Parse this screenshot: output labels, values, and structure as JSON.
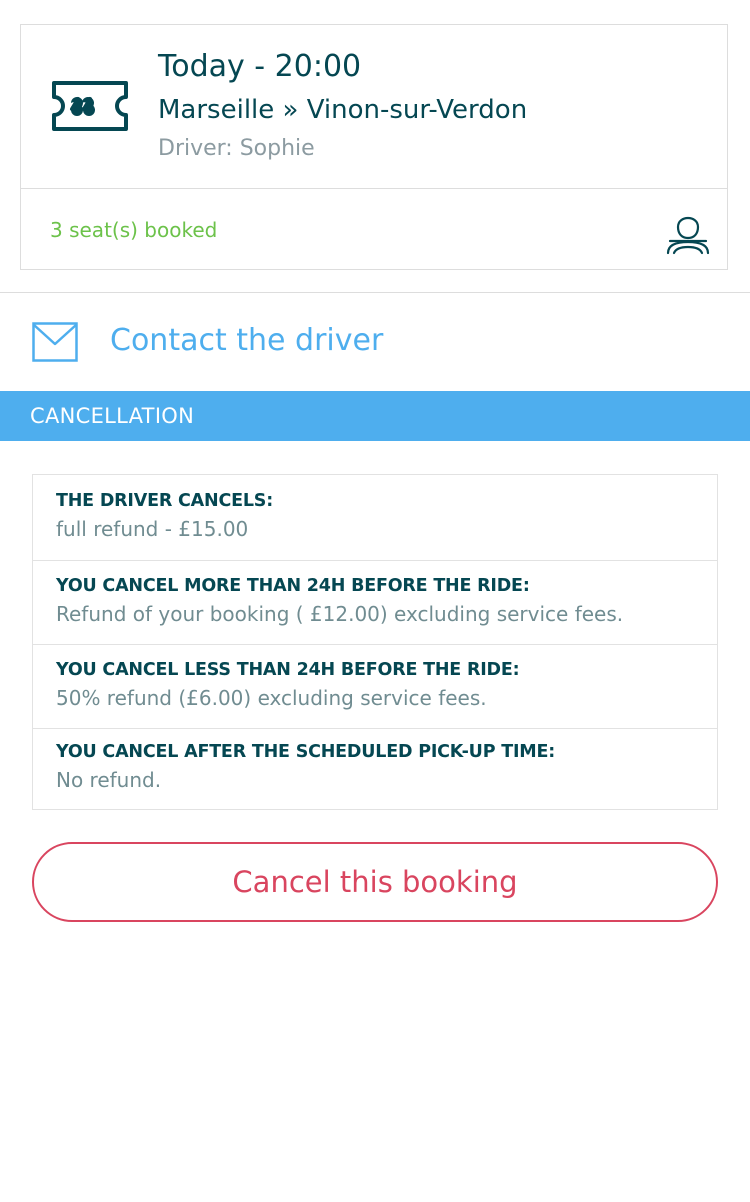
{
  "booking": {
    "time": "Today - 20:00",
    "route": "Marseille » Vinon-sur-Verdon",
    "driver": "Driver: Sophie",
    "seats": "3 seat(s) booked",
    "ticket_icon": "ticket-icon",
    "passenger_icon": "passenger-icon"
  },
  "contact": {
    "label": "Contact the driver",
    "icon": "mail-icon"
  },
  "cancellation": {
    "header": "CANCELLATION",
    "policies": [
      {
        "title": "THE DRIVER CANCELS:",
        "description": "full refund - £15.00"
      },
      {
        "title": "YOU CANCEL MORE THAN 24H BEFORE THE RIDE:",
        "description": "Refund of your booking ( £12.00) excluding service fees."
      },
      {
        "title": "YOU CANCEL LESS THAN 24H BEFORE THE RIDE:",
        "description": "50% refund (£6.00) excluding service fees."
      },
      {
        "title": "YOU CANCEL AFTER THE SCHEDULED PICK-UP TIME:",
        "description": "No refund."
      }
    ],
    "button_label": "Cancel this booking"
  },
  "colors": {
    "primary_dark": "#054752",
    "accent_blue": "#4eaeee",
    "success_green": "#6cc24a",
    "danger_red": "#d9455f",
    "muted_text": "#708c91"
  }
}
